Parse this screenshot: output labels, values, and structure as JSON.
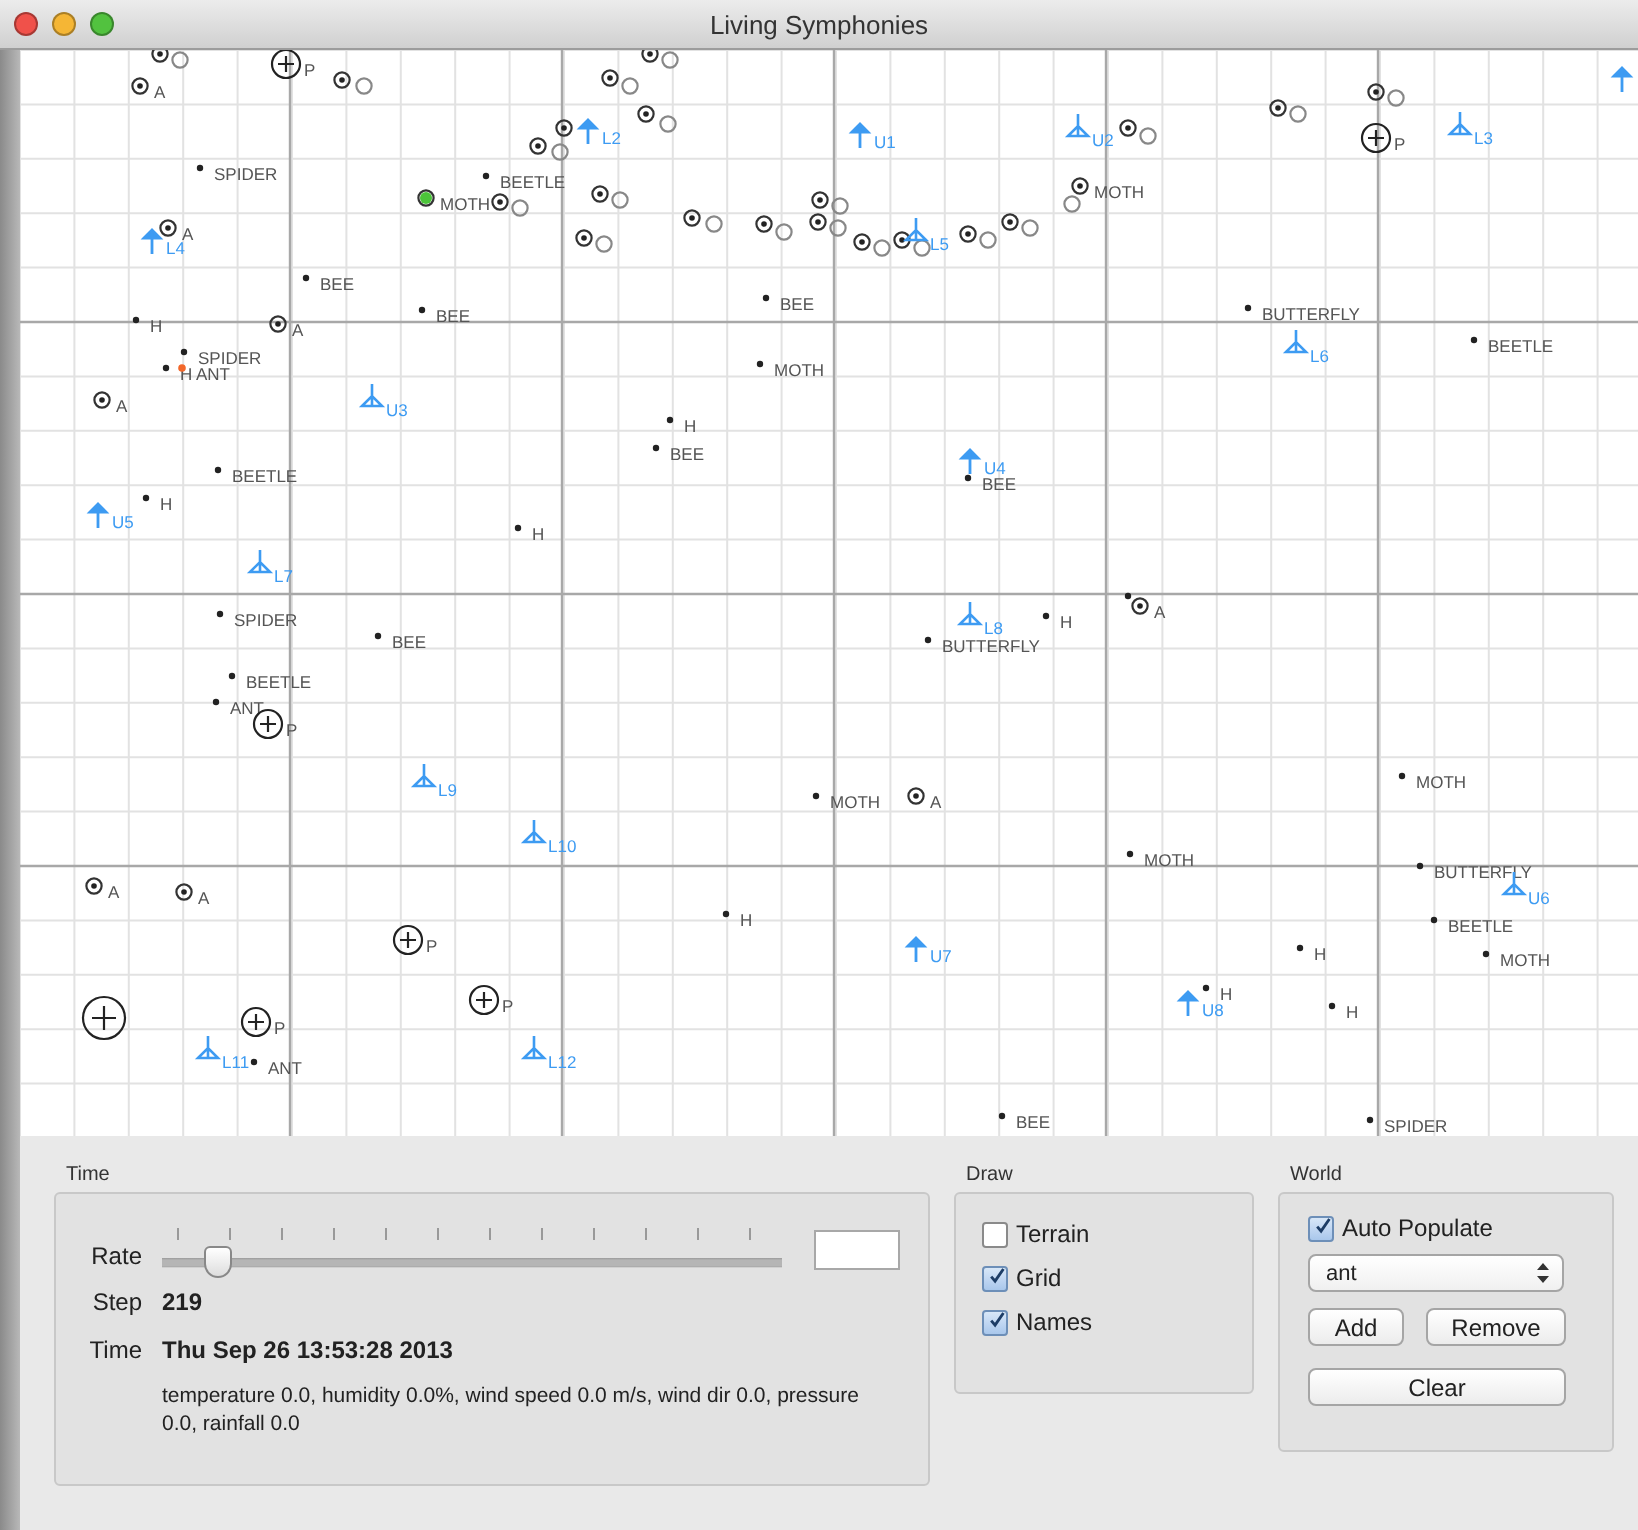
{
  "window": {
    "title": "Living Symphonies"
  },
  "world_view": {
    "entities": [
      {
        "kind": "target"
      },
      {
        "kind": "ring"
      },
      {
        "kind": "target",
        "label": "A"
      },
      {
        "kind": "crosshair",
        "label": "P"
      },
      {
        "kind": "target"
      },
      {
        "kind": "ring"
      },
      {
        "kind": "target"
      },
      {
        "kind": "ring"
      },
      {
        "kind": "target"
      },
      {
        "kind": "ring"
      },
      {
        "kind": "target"
      },
      {
        "kind": "ring"
      },
      {
        "kind": "target"
      },
      {
        "kind": "arrow",
        "label": "L2"
      },
      {
        "kind": "target"
      },
      {
        "kind": "ring"
      },
      {
        "kind": "dot",
        "label": "SPIDER"
      },
      {
        "kind": "dot",
        "label": "BEETLE"
      },
      {
        "kind": "target",
        "label": "MOTH",
        "color": "#4cc43a"
      },
      {
        "kind": "target"
      },
      {
        "kind": "ring"
      },
      {
        "kind": "target"
      },
      {
        "kind": "ring"
      },
      {
        "kind": "target"
      },
      {
        "kind": "ring"
      },
      {
        "kind": "target"
      },
      {
        "kind": "ring"
      },
      {
        "kind": "target"
      },
      {
        "kind": "ring"
      },
      {
        "kind": "target"
      },
      {
        "kind": "ring"
      },
      {
        "kind": "target"
      },
      {
        "kind": "ring"
      },
      {
        "kind": "target"
      },
      {
        "kind": "ring"
      },
      {
        "kind": "target"
      },
      {
        "kind": "ring"
      },
      {
        "kind": "antenna",
        "label": "L5"
      },
      {
        "kind": "target"
      },
      {
        "kind": "ring"
      },
      {
        "kind": "target"
      },
      {
        "kind": "ring"
      },
      {
        "kind": "target",
        "label": "MOTH"
      },
      {
        "kind": "ring"
      },
      {
        "kind": "arrow",
        "label": "U1"
      },
      {
        "kind": "antenna",
        "label": "U2"
      },
      {
        "kind": "target"
      },
      {
        "kind": "ring"
      },
      {
        "kind": "target"
      },
      {
        "kind": "ring"
      },
      {
        "kind": "target"
      },
      {
        "kind": "ring"
      },
      {
        "kind": "crosshair",
        "label": "P"
      },
      {
        "kind": "antenna",
        "label": "L3"
      },
      {
        "kind": "arrow"
      },
      {
        "kind": "target",
        "label": "A"
      },
      {
        "kind": "arrow",
        "label": "L4"
      },
      {
        "kind": "dot",
        "label": "BEE"
      },
      {
        "kind": "dot",
        "label": "BEE"
      },
      {
        "kind": "dot",
        "label": "BEE"
      },
      {
        "kind": "dot",
        "label": "H"
      },
      {
        "kind": "target",
        "label": "A"
      },
      {
        "kind": "dot",
        "label": "SPIDER"
      },
      {
        "kind": "dot",
        "label": "H"
      },
      {
        "kind": "dot",
        "label": "ANT",
        "color": "#f2672a"
      },
      {
        "kind": "target",
        "label": "A"
      },
      {
        "kind": "antenna",
        "label": "U3"
      },
      {
        "kind": "dot",
        "label": "MOTH"
      },
      {
        "kind": "dot",
        "label": "H"
      },
      {
        "kind": "dot",
        "label": "BEE"
      },
      {
        "kind": "dot",
        "label": "BEETLE"
      },
      {
        "kind": "dot",
        "label": "H"
      },
      {
        "kind": "arrow",
        "label": "U5"
      },
      {
        "kind": "dot",
        "label": "H"
      },
      {
        "kind": "antenna",
        "label": "L7"
      },
      {
        "kind": "dot",
        "label": "BUTTERFLY"
      },
      {
        "kind": "antenna",
        "label": "L6"
      },
      {
        "kind": "dot",
        "label": "BEETLE"
      },
      {
        "kind": "arrow",
        "label": "U4"
      },
      {
        "kind": "dot",
        "label": "BEE"
      },
      {
        "kind": "dot",
        "label": "SPIDER"
      },
      {
        "kind": "dot",
        "label": "BEE"
      },
      {
        "kind": "dot",
        "label": "BEETLE"
      },
      {
        "kind": "dot",
        "label": "ANT"
      },
      {
        "kind": "crosshair",
        "label": "P"
      },
      {
        "kind": "antenna",
        "label": "L9"
      },
      {
        "kind": "antenna",
        "label": "L10"
      },
      {
        "kind": "target",
        "label": "A"
      },
      {
        "kind": "target",
        "label": "A"
      },
      {
        "kind": "dot",
        "label": "H"
      },
      {
        "kind": "crosshair",
        "label": "P"
      },
      {
        "kind": "crosshair",
        "label": "P"
      },
      {
        "kind": "bigcrosshair"
      },
      {
        "kind": "crosshair",
        "label": "P"
      },
      {
        "kind": "antenna",
        "label": "L11"
      },
      {
        "kind": "dot",
        "label": "ANT"
      },
      {
        "kind": "antenna",
        "label": "L12"
      },
      {
        "kind": "antenna",
        "label": "L8"
      },
      {
        "kind": "dot",
        "label": "H"
      },
      {
        "kind": "dot"
      },
      {
        "kind": "target",
        "label": "A"
      },
      {
        "kind": "dot",
        "label": "BUTTERFLY"
      },
      {
        "kind": "dot",
        "label": "MOTH"
      },
      {
        "kind": "dot",
        "label": "MOTH"
      },
      {
        "kind": "target",
        "label": "A"
      },
      {
        "kind": "dot",
        "label": "MOTH"
      },
      {
        "kind": "dot",
        "label": "BUTTERFLY"
      },
      {
        "kind": "antenna",
        "label": "U6"
      },
      {
        "kind": "dot",
        "label": "BEETLE"
      },
      {
        "kind": "arrow",
        "label": "U7"
      },
      {
        "kind": "dot",
        "label": "H"
      },
      {
        "kind": "dot",
        "label": "MOTH"
      },
      {
        "kind": "arrow",
        "label": "U8"
      },
      {
        "kind": "dot",
        "label": "H"
      },
      {
        "kind": "dot",
        "label": "H"
      },
      {
        "kind": "dot",
        "label": "BEE"
      },
      {
        "kind": "dot",
        "label": "SPIDER"
      }
    ]
  },
  "time": {
    "title": "Time",
    "rate": {
      "label": "Rate",
      "level": 0.09
    },
    "step": {
      "label": "Step",
      "value": "219"
    },
    "clock": {
      "label": "Time",
      "value": "Thu Sep 26 13:53:28 2013"
    },
    "weather": "temperature 0.0, humidity 0.0%, wind speed 0.0 m/s, wind dir 0.0, pressure 0.0, rainfall 0.0"
  },
  "draw": {
    "title": "Draw",
    "options": [
      {
        "label": "Terrain",
        "checked": false
      },
      {
        "label": "Grid",
        "checked": true
      },
      {
        "label": "Names",
        "checked": true
      }
    ]
  },
  "world": {
    "title": "World",
    "auto_populate": {
      "label": "Auto Populate",
      "checked": true
    },
    "species": {
      "value": "ant"
    },
    "buttons": [
      "Add",
      "Remove",
      "Clear"
    ]
  }
}
